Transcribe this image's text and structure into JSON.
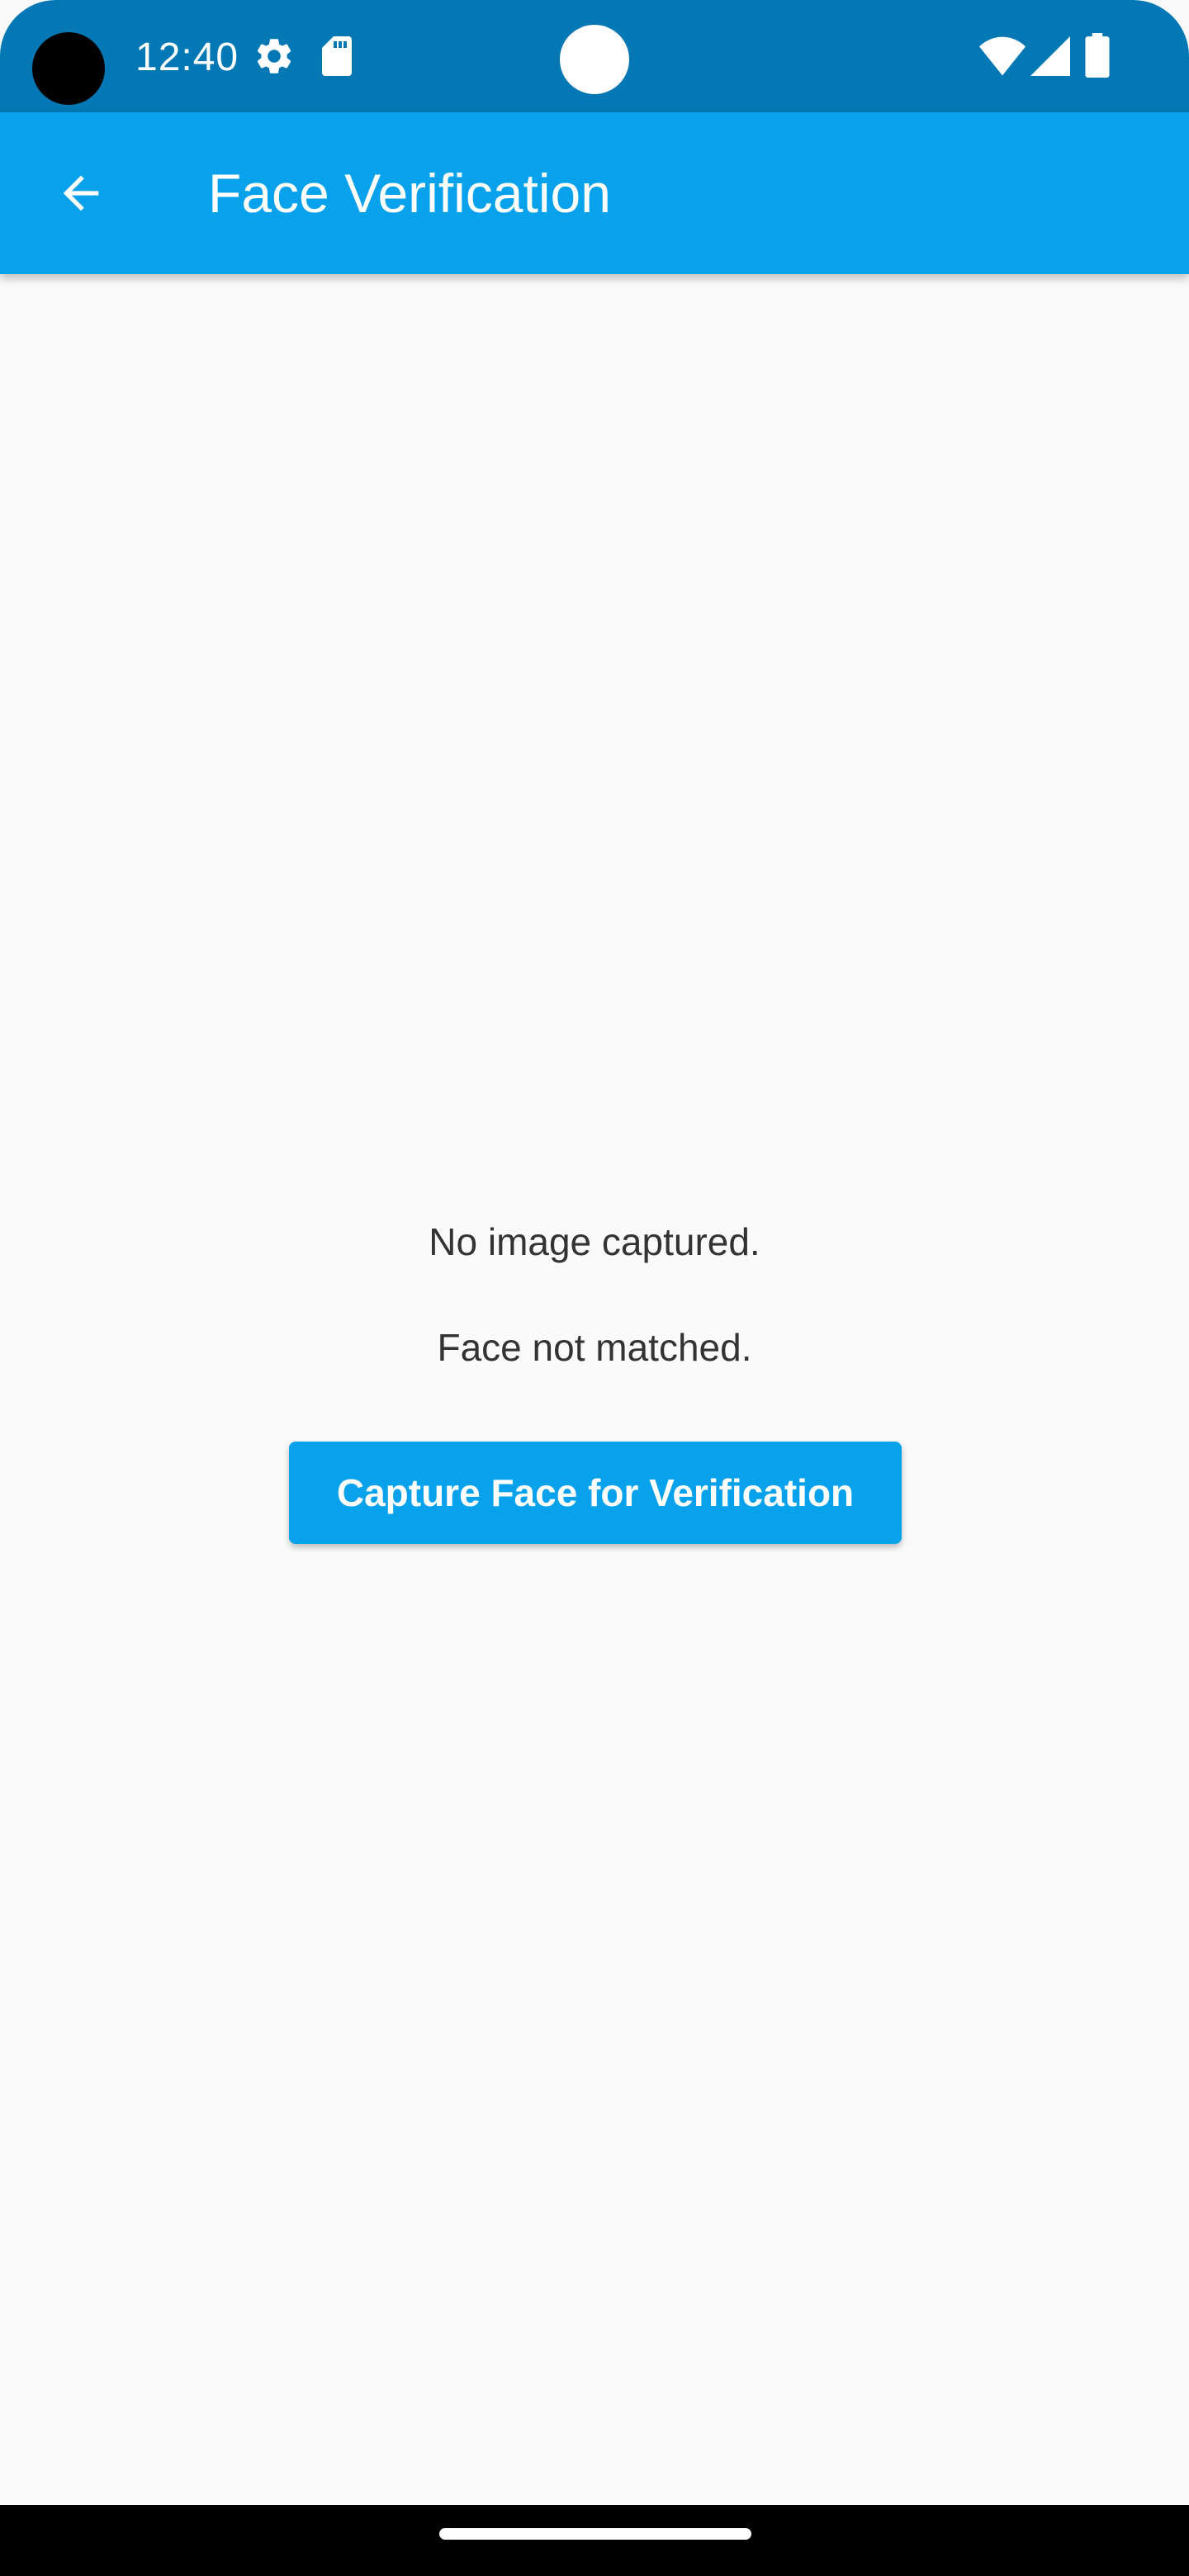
{
  "status_bar": {
    "time": "12:40",
    "icons": [
      "settings-gear-icon",
      "sd-card-icon",
      "wifi-icon",
      "cellular-signal-icon",
      "battery-icon"
    ],
    "background_color": "#0378B4"
  },
  "app_bar": {
    "title": "Face Verification",
    "back_icon": "arrow-back-icon",
    "background_color": "#07A2EB"
  },
  "main": {
    "image_status": "No image captured.",
    "match_status": "Face not matched.",
    "capture_button_label": "Capture Face for Verification",
    "button_color": "#07A2EB",
    "background_color": "#FAFAFA"
  },
  "nav_bar": {
    "home_indicator": "gesture-handle"
  }
}
